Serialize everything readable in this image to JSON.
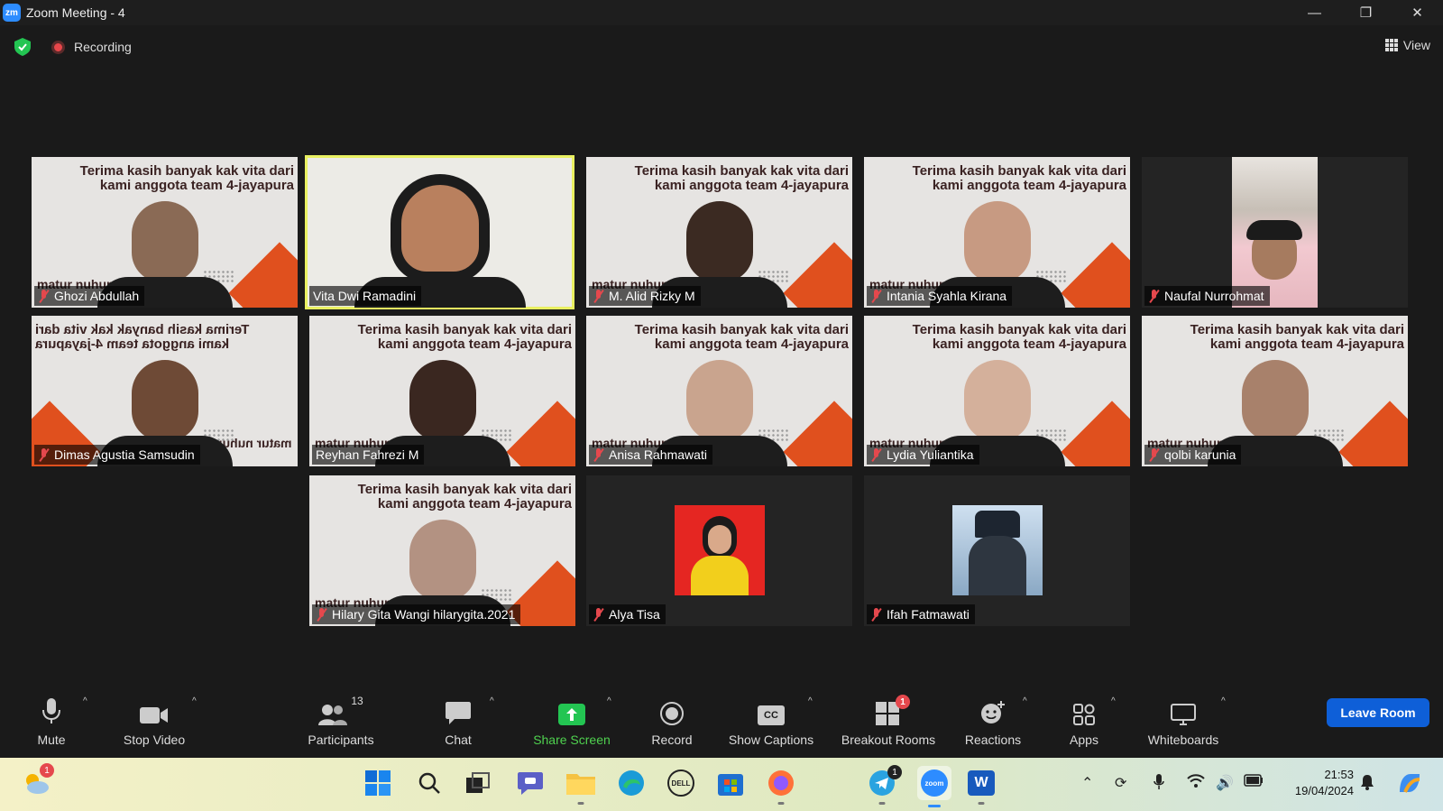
{
  "window": {
    "title": "Zoom Meeting - 4",
    "logo": "zm"
  },
  "status": {
    "recording_label": "Recording",
    "view_label": "View"
  },
  "slide": {
    "line1": "Terima kasih banyak kak vita  dari",
    "line2": "kami anggota team 4-jayapura",
    "footer": "matur nuhun"
  },
  "participants": [
    {
      "name": "Ghozi Abdullah",
      "muted": true,
      "kind": "slide",
      "skin": "#8a6a55"
    },
    {
      "name": "Vita Dwi Ramadini",
      "muted": false,
      "kind": "camera",
      "active": true
    },
    {
      "name": "M. Alid Rizky M",
      "muted": true,
      "kind": "slide",
      "skin": "#3b2a22"
    },
    {
      "name": "Intania Syahla Kirana",
      "muted": true,
      "kind": "slide",
      "skin": "#c79a82"
    },
    {
      "name": "Naufal Nurrohmat",
      "muted": true,
      "kind": "photo"
    },
    {
      "name": "Dimas Agustia Samsudin",
      "muted": true,
      "kind": "slide-mirror",
      "skin": "#6e4a36"
    },
    {
      "name": "Reyhan Fahrezi M",
      "muted": false,
      "kind": "slide",
      "skin": "#3a2720"
    },
    {
      "name": "Anisa Rahmawati",
      "muted": true,
      "kind": "slide",
      "skin": "#c9a48e"
    },
    {
      "name": "Lydia Yuliantika",
      "muted": true,
      "kind": "slide",
      "skin": "#d4b09b"
    },
    {
      "name": "qolbi karunia",
      "muted": true,
      "kind": "slide",
      "skin": "#a8816b"
    },
    {
      "name": "Hilary Gita Wangi hilarygita.2021",
      "muted": true,
      "kind": "slide",
      "skin": "#b39282"
    },
    {
      "name": "Alya Tisa",
      "muted": true,
      "kind": "photo"
    },
    {
      "name": "Ifah Fatmawati",
      "muted": true,
      "kind": "photo"
    }
  ],
  "toolbar": {
    "mute": "Mute",
    "stop_video": "Stop Video",
    "participants": "Participants",
    "participants_count": "13",
    "chat": "Chat",
    "share_screen": "Share Screen",
    "record": "Record",
    "show_captions": "Show Captions",
    "captions_icon": "CC",
    "breakout_rooms": "Breakout Rooms",
    "breakout_badge": "1",
    "reactions": "Reactions",
    "apps": "Apps",
    "whiteboards": "Whiteboards",
    "leave": "Leave Room"
  },
  "taskbar": {
    "weather_badge": "1",
    "telegram_badge": "1",
    "dell_label": "DELL",
    "zoom_label": "zoom",
    "word_label": "W",
    "time": "21:53",
    "date": "19/04/2024"
  },
  "colors": {
    "accent": "#2d8cff",
    "active_speaker": "#e9f061",
    "share_green": "#4fd14f",
    "leave_blue": "#0e5fd8",
    "slide_orange": "#e0501e",
    "muted_red": "#e5484d"
  }
}
